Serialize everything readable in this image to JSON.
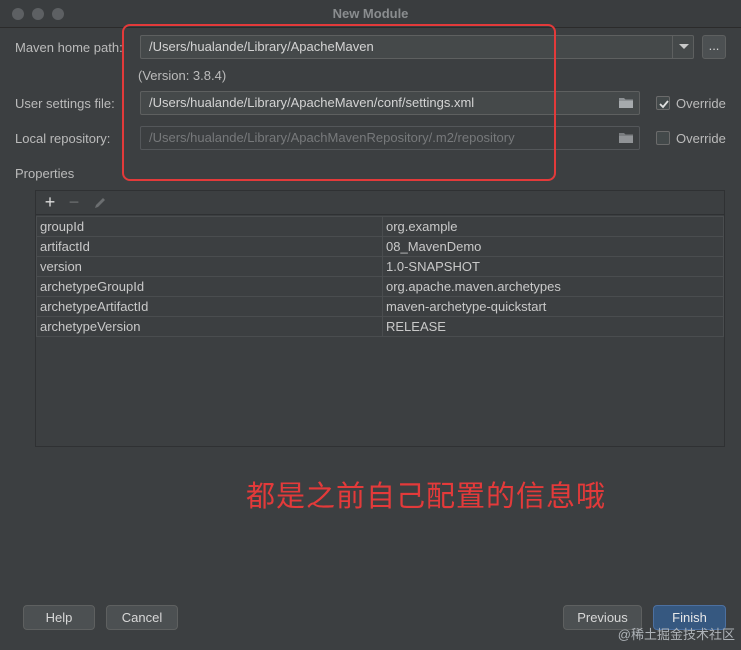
{
  "window": {
    "title": "New Module"
  },
  "maven_home": {
    "label": "Maven home path:",
    "value": "/Users/hualande/Library/ApacheMaven",
    "browse_label": "..."
  },
  "version": {
    "text": "(Version: 3.8.4)"
  },
  "user_settings": {
    "label": "User settings file:",
    "value": "/Users/hualande/Library/ApacheMaven/conf/settings.xml",
    "override_label": "Override",
    "override_checked": true
  },
  "local_repo": {
    "label": "Local repository:",
    "value": "/Users/hualande/Library/ApachMavenRepository/.m2/repository",
    "override_label": "Override",
    "override_checked": false
  },
  "properties": {
    "label": "Properties",
    "toolbar": {
      "add": "+",
      "remove": "−"
    },
    "rows": [
      {
        "key": "groupId",
        "value": "org.example"
      },
      {
        "key": "artifactId",
        "value": "08_MavenDemo"
      },
      {
        "key": "version",
        "value": "1.0-SNAPSHOT"
      },
      {
        "key": "archetypeGroupId",
        "value": "org.apache.maven.archetypes"
      },
      {
        "key": "archetypeArtifactId",
        "value": "maven-archetype-quickstart"
      },
      {
        "key": "archetypeVersion",
        "value": "RELEASE"
      }
    ]
  },
  "annotation": {
    "text": "都是之前自己配置的信息哦",
    "color": "#e33a3a"
  },
  "buttons": {
    "help": "Help",
    "cancel": "Cancel",
    "previous": "Previous",
    "finish": "Finish"
  },
  "watermark": {
    "text": "@稀土掘金技术社区"
  }
}
